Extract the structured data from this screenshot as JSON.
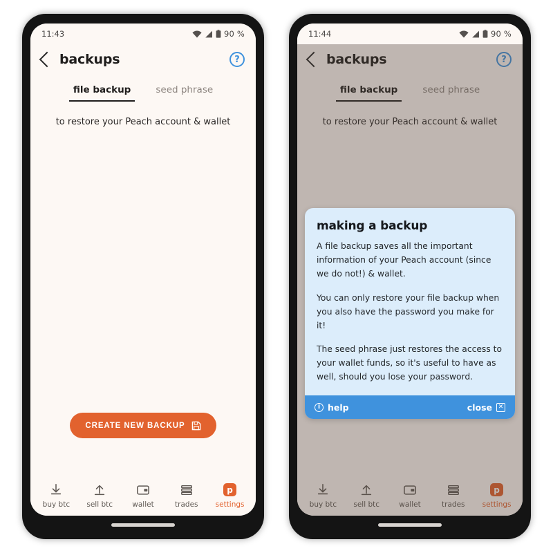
{
  "theme": {
    "accent_orange": "#e2622e",
    "accent_blue": "#3f92dd",
    "popup_bg": "#dcedfb",
    "screen_bg": "#fdf8f4",
    "overlay_dim": "#a9a29d",
    "text_dark": "#1f1d1c"
  },
  "phones": [
    {
      "id": "left",
      "status_bar": {
        "time": "11:43",
        "battery_percent": "90 %",
        "icons": [
          "wifi-icon",
          "cellular-signal-icon",
          "battery-icon"
        ]
      },
      "header": {
        "back_icon": "chevron-left-icon",
        "title": "backups",
        "help_icon_label": "?"
      },
      "tabs": [
        {
          "label": "file backup",
          "active": true
        },
        {
          "label": "seed phrase",
          "active": false
        }
      ],
      "subtitle": "to restore your Peach account & wallet",
      "cta": {
        "label": "CREATE NEW BACKUP",
        "icon": "save-disk-icon"
      },
      "popup_visible": false
    },
    {
      "id": "right",
      "status_bar": {
        "time": "11:44",
        "battery_percent": "90 %",
        "icons": [
          "wifi-icon",
          "cellular-signal-icon",
          "battery-icon"
        ]
      },
      "header": {
        "back_icon": "chevron-left-icon",
        "title": "backups",
        "help_icon_label": "?"
      },
      "tabs": [
        {
          "label": "file backup",
          "active": true
        },
        {
          "label": "seed phrase",
          "active": false
        }
      ],
      "subtitle": "to restore your Peach account & wallet",
      "cta": {
        "label": "CREATE NEW BACKUP",
        "icon": "save-disk-icon"
      },
      "popup_visible": true
    }
  ],
  "popup": {
    "title": "making a backup",
    "paragraphs": [
      "A file backup saves all the important information of your Peach account (since we do not!) & wallet.",
      "You can only restore your file backup when you also have the password you make for it!",
      "The seed phrase just restores the access to your wallet funds, so it's useful to have as well, should you lose your password."
    ],
    "footer": {
      "help_label": "help",
      "help_icon": "info-circle-icon",
      "close_label": "close",
      "close_icon": "close-box-icon"
    }
  },
  "bottom_nav": [
    {
      "label": "buy btc",
      "icon": "download-arrow-icon",
      "active": false
    },
    {
      "label": "sell btc",
      "icon": "upload-arrow-icon",
      "active": false
    },
    {
      "label": "wallet",
      "icon": "wallet-icon",
      "active": false
    },
    {
      "label": "trades",
      "icon": "stacked-bars-icon",
      "active": false
    },
    {
      "label": "settings",
      "icon": "peach-logo-icon",
      "active": true
    }
  ]
}
